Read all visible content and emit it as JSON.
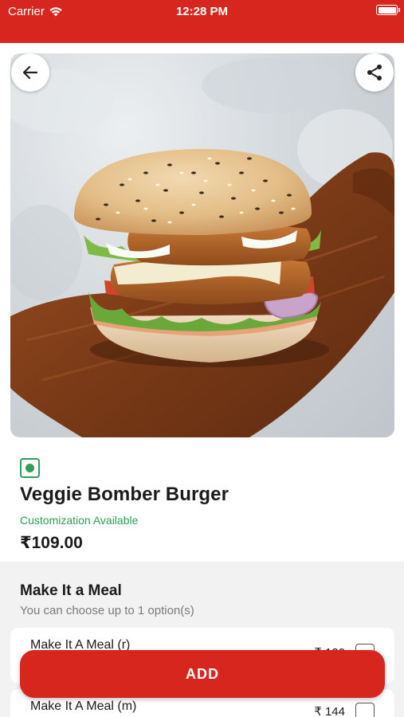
{
  "status_bar": {
    "carrier": "Carrier",
    "time": "12:28 PM",
    "battery_level": 1.0
  },
  "hero": {
    "back_icon": "arrow-left-icon",
    "share_icon": "share-icon",
    "image_subject": "burger"
  },
  "product": {
    "veg_icon": "veg-indicator-icon",
    "title": "Veggie Bomber Burger",
    "customization_note": "Customization Available",
    "price": "₹109.00"
  },
  "meal_section": {
    "title": "Make It a Meal",
    "subtitle": "You can choose up to 1 option(s)",
    "options": [
      {
        "name": "Make It A Meal (r)",
        "price": "₹ 120",
        "checked": false
      },
      {
        "name": "Make It A Meal (m)",
        "price": "₹ 144",
        "checked": false
      }
    ]
  },
  "add_button": {
    "label": "ADD"
  },
  "colors": {
    "brand_red": "#d7261e",
    "veg_green": "#2f9e58",
    "section_bg": "#f2f2f2"
  }
}
